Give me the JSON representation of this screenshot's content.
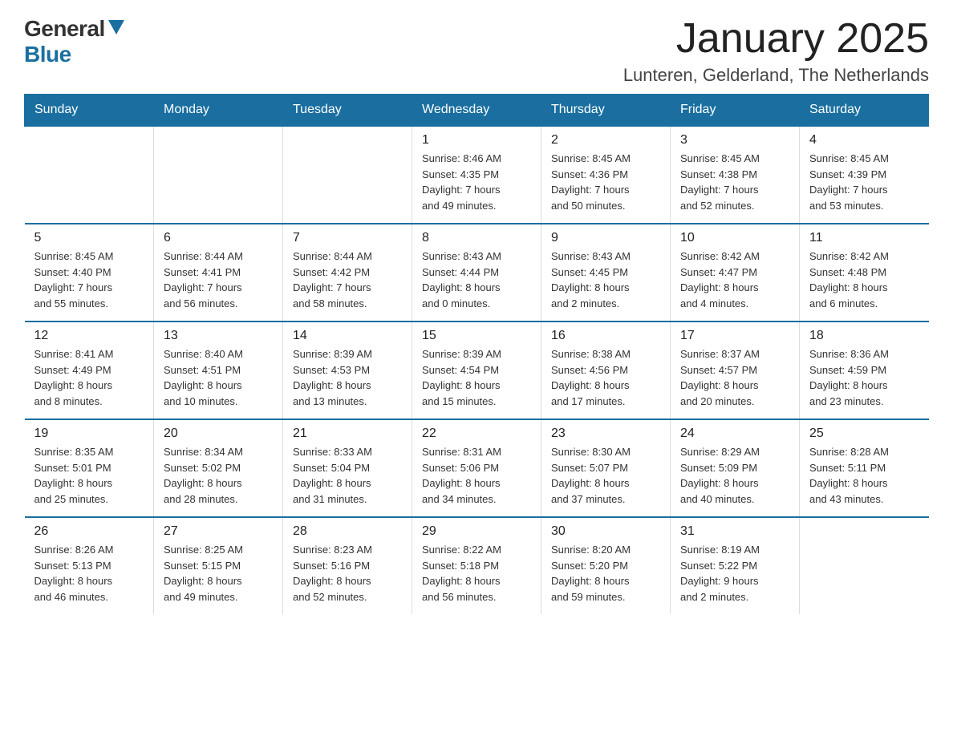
{
  "logo": {
    "general": "General",
    "blue": "Blue"
  },
  "header": {
    "title": "January 2025",
    "subtitle": "Lunteren, Gelderland, The Netherlands"
  },
  "days_of_week": [
    "Sunday",
    "Monday",
    "Tuesday",
    "Wednesday",
    "Thursday",
    "Friday",
    "Saturday"
  ],
  "weeks": [
    [
      {
        "day": "",
        "info": ""
      },
      {
        "day": "",
        "info": ""
      },
      {
        "day": "",
        "info": ""
      },
      {
        "day": "1",
        "info": "Sunrise: 8:46 AM\nSunset: 4:35 PM\nDaylight: 7 hours\nand 49 minutes."
      },
      {
        "day": "2",
        "info": "Sunrise: 8:45 AM\nSunset: 4:36 PM\nDaylight: 7 hours\nand 50 minutes."
      },
      {
        "day": "3",
        "info": "Sunrise: 8:45 AM\nSunset: 4:38 PM\nDaylight: 7 hours\nand 52 minutes."
      },
      {
        "day": "4",
        "info": "Sunrise: 8:45 AM\nSunset: 4:39 PM\nDaylight: 7 hours\nand 53 minutes."
      }
    ],
    [
      {
        "day": "5",
        "info": "Sunrise: 8:45 AM\nSunset: 4:40 PM\nDaylight: 7 hours\nand 55 minutes."
      },
      {
        "day": "6",
        "info": "Sunrise: 8:44 AM\nSunset: 4:41 PM\nDaylight: 7 hours\nand 56 minutes."
      },
      {
        "day": "7",
        "info": "Sunrise: 8:44 AM\nSunset: 4:42 PM\nDaylight: 7 hours\nand 58 minutes."
      },
      {
        "day": "8",
        "info": "Sunrise: 8:43 AM\nSunset: 4:44 PM\nDaylight: 8 hours\nand 0 minutes."
      },
      {
        "day": "9",
        "info": "Sunrise: 8:43 AM\nSunset: 4:45 PM\nDaylight: 8 hours\nand 2 minutes."
      },
      {
        "day": "10",
        "info": "Sunrise: 8:42 AM\nSunset: 4:47 PM\nDaylight: 8 hours\nand 4 minutes."
      },
      {
        "day": "11",
        "info": "Sunrise: 8:42 AM\nSunset: 4:48 PM\nDaylight: 8 hours\nand 6 minutes."
      }
    ],
    [
      {
        "day": "12",
        "info": "Sunrise: 8:41 AM\nSunset: 4:49 PM\nDaylight: 8 hours\nand 8 minutes."
      },
      {
        "day": "13",
        "info": "Sunrise: 8:40 AM\nSunset: 4:51 PM\nDaylight: 8 hours\nand 10 minutes."
      },
      {
        "day": "14",
        "info": "Sunrise: 8:39 AM\nSunset: 4:53 PM\nDaylight: 8 hours\nand 13 minutes."
      },
      {
        "day": "15",
        "info": "Sunrise: 8:39 AM\nSunset: 4:54 PM\nDaylight: 8 hours\nand 15 minutes."
      },
      {
        "day": "16",
        "info": "Sunrise: 8:38 AM\nSunset: 4:56 PM\nDaylight: 8 hours\nand 17 minutes."
      },
      {
        "day": "17",
        "info": "Sunrise: 8:37 AM\nSunset: 4:57 PM\nDaylight: 8 hours\nand 20 minutes."
      },
      {
        "day": "18",
        "info": "Sunrise: 8:36 AM\nSunset: 4:59 PM\nDaylight: 8 hours\nand 23 minutes."
      }
    ],
    [
      {
        "day": "19",
        "info": "Sunrise: 8:35 AM\nSunset: 5:01 PM\nDaylight: 8 hours\nand 25 minutes."
      },
      {
        "day": "20",
        "info": "Sunrise: 8:34 AM\nSunset: 5:02 PM\nDaylight: 8 hours\nand 28 minutes."
      },
      {
        "day": "21",
        "info": "Sunrise: 8:33 AM\nSunset: 5:04 PM\nDaylight: 8 hours\nand 31 minutes."
      },
      {
        "day": "22",
        "info": "Sunrise: 8:31 AM\nSunset: 5:06 PM\nDaylight: 8 hours\nand 34 minutes."
      },
      {
        "day": "23",
        "info": "Sunrise: 8:30 AM\nSunset: 5:07 PM\nDaylight: 8 hours\nand 37 minutes."
      },
      {
        "day": "24",
        "info": "Sunrise: 8:29 AM\nSunset: 5:09 PM\nDaylight: 8 hours\nand 40 minutes."
      },
      {
        "day": "25",
        "info": "Sunrise: 8:28 AM\nSunset: 5:11 PM\nDaylight: 8 hours\nand 43 minutes."
      }
    ],
    [
      {
        "day": "26",
        "info": "Sunrise: 8:26 AM\nSunset: 5:13 PM\nDaylight: 8 hours\nand 46 minutes."
      },
      {
        "day": "27",
        "info": "Sunrise: 8:25 AM\nSunset: 5:15 PM\nDaylight: 8 hours\nand 49 minutes."
      },
      {
        "day": "28",
        "info": "Sunrise: 8:23 AM\nSunset: 5:16 PM\nDaylight: 8 hours\nand 52 minutes."
      },
      {
        "day": "29",
        "info": "Sunrise: 8:22 AM\nSunset: 5:18 PM\nDaylight: 8 hours\nand 56 minutes."
      },
      {
        "day": "30",
        "info": "Sunrise: 8:20 AM\nSunset: 5:20 PM\nDaylight: 8 hours\nand 59 minutes."
      },
      {
        "day": "31",
        "info": "Sunrise: 8:19 AM\nSunset: 5:22 PM\nDaylight: 9 hours\nand 2 minutes."
      },
      {
        "day": "",
        "info": ""
      }
    ]
  ]
}
